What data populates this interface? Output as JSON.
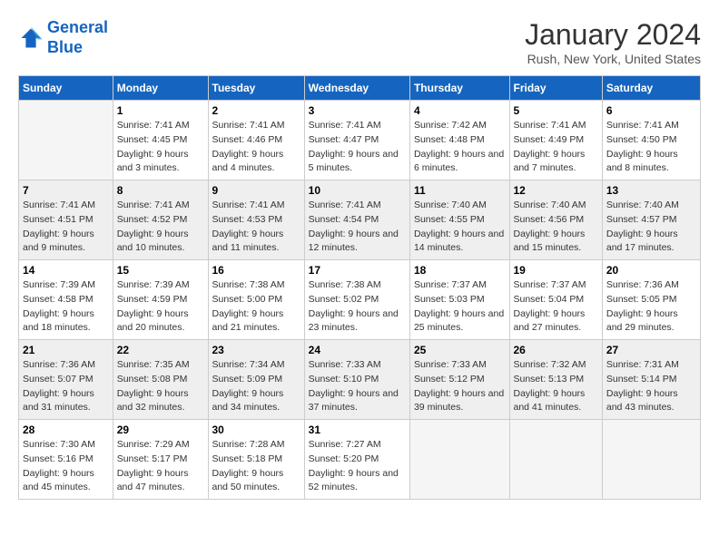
{
  "header": {
    "logo_line1": "General",
    "logo_line2": "Blue",
    "title": "January 2024",
    "subtitle": "Rush, New York, United States"
  },
  "days_of_week": [
    "Sunday",
    "Monday",
    "Tuesday",
    "Wednesday",
    "Thursday",
    "Friday",
    "Saturday"
  ],
  "weeks": [
    [
      {
        "num": "",
        "sunrise": "",
        "sunset": "",
        "daylight": "",
        "empty": true
      },
      {
        "num": "1",
        "sunrise": "Sunrise: 7:41 AM",
        "sunset": "Sunset: 4:45 PM",
        "daylight": "Daylight: 9 hours and 3 minutes."
      },
      {
        "num": "2",
        "sunrise": "Sunrise: 7:41 AM",
        "sunset": "Sunset: 4:46 PM",
        "daylight": "Daylight: 9 hours and 4 minutes."
      },
      {
        "num": "3",
        "sunrise": "Sunrise: 7:41 AM",
        "sunset": "Sunset: 4:47 PM",
        "daylight": "Daylight: 9 hours and 5 minutes."
      },
      {
        "num": "4",
        "sunrise": "Sunrise: 7:42 AM",
        "sunset": "Sunset: 4:48 PM",
        "daylight": "Daylight: 9 hours and 6 minutes."
      },
      {
        "num": "5",
        "sunrise": "Sunrise: 7:41 AM",
        "sunset": "Sunset: 4:49 PM",
        "daylight": "Daylight: 9 hours and 7 minutes."
      },
      {
        "num": "6",
        "sunrise": "Sunrise: 7:41 AM",
        "sunset": "Sunset: 4:50 PM",
        "daylight": "Daylight: 9 hours and 8 minutes."
      }
    ],
    [
      {
        "num": "7",
        "sunrise": "Sunrise: 7:41 AM",
        "sunset": "Sunset: 4:51 PM",
        "daylight": "Daylight: 9 hours and 9 minutes."
      },
      {
        "num": "8",
        "sunrise": "Sunrise: 7:41 AM",
        "sunset": "Sunset: 4:52 PM",
        "daylight": "Daylight: 9 hours and 10 minutes."
      },
      {
        "num": "9",
        "sunrise": "Sunrise: 7:41 AM",
        "sunset": "Sunset: 4:53 PM",
        "daylight": "Daylight: 9 hours and 11 minutes."
      },
      {
        "num": "10",
        "sunrise": "Sunrise: 7:41 AM",
        "sunset": "Sunset: 4:54 PM",
        "daylight": "Daylight: 9 hours and 12 minutes."
      },
      {
        "num": "11",
        "sunrise": "Sunrise: 7:40 AM",
        "sunset": "Sunset: 4:55 PM",
        "daylight": "Daylight: 9 hours and 14 minutes."
      },
      {
        "num": "12",
        "sunrise": "Sunrise: 7:40 AM",
        "sunset": "Sunset: 4:56 PM",
        "daylight": "Daylight: 9 hours and 15 minutes."
      },
      {
        "num": "13",
        "sunrise": "Sunrise: 7:40 AM",
        "sunset": "Sunset: 4:57 PM",
        "daylight": "Daylight: 9 hours and 17 minutes."
      }
    ],
    [
      {
        "num": "14",
        "sunrise": "Sunrise: 7:39 AM",
        "sunset": "Sunset: 4:58 PM",
        "daylight": "Daylight: 9 hours and 18 minutes."
      },
      {
        "num": "15",
        "sunrise": "Sunrise: 7:39 AM",
        "sunset": "Sunset: 4:59 PM",
        "daylight": "Daylight: 9 hours and 20 minutes."
      },
      {
        "num": "16",
        "sunrise": "Sunrise: 7:38 AM",
        "sunset": "Sunset: 5:00 PM",
        "daylight": "Daylight: 9 hours and 21 minutes."
      },
      {
        "num": "17",
        "sunrise": "Sunrise: 7:38 AM",
        "sunset": "Sunset: 5:02 PM",
        "daylight": "Daylight: 9 hours and 23 minutes."
      },
      {
        "num": "18",
        "sunrise": "Sunrise: 7:37 AM",
        "sunset": "Sunset: 5:03 PM",
        "daylight": "Daylight: 9 hours and 25 minutes."
      },
      {
        "num": "19",
        "sunrise": "Sunrise: 7:37 AM",
        "sunset": "Sunset: 5:04 PM",
        "daylight": "Daylight: 9 hours and 27 minutes."
      },
      {
        "num": "20",
        "sunrise": "Sunrise: 7:36 AM",
        "sunset": "Sunset: 5:05 PM",
        "daylight": "Daylight: 9 hours and 29 minutes."
      }
    ],
    [
      {
        "num": "21",
        "sunrise": "Sunrise: 7:36 AM",
        "sunset": "Sunset: 5:07 PM",
        "daylight": "Daylight: 9 hours and 31 minutes."
      },
      {
        "num": "22",
        "sunrise": "Sunrise: 7:35 AM",
        "sunset": "Sunset: 5:08 PM",
        "daylight": "Daylight: 9 hours and 32 minutes."
      },
      {
        "num": "23",
        "sunrise": "Sunrise: 7:34 AM",
        "sunset": "Sunset: 5:09 PM",
        "daylight": "Daylight: 9 hours and 34 minutes."
      },
      {
        "num": "24",
        "sunrise": "Sunrise: 7:33 AM",
        "sunset": "Sunset: 5:10 PM",
        "daylight": "Daylight: 9 hours and 37 minutes."
      },
      {
        "num": "25",
        "sunrise": "Sunrise: 7:33 AM",
        "sunset": "Sunset: 5:12 PM",
        "daylight": "Daylight: 9 hours and 39 minutes."
      },
      {
        "num": "26",
        "sunrise": "Sunrise: 7:32 AM",
        "sunset": "Sunset: 5:13 PM",
        "daylight": "Daylight: 9 hours and 41 minutes."
      },
      {
        "num": "27",
        "sunrise": "Sunrise: 7:31 AM",
        "sunset": "Sunset: 5:14 PM",
        "daylight": "Daylight: 9 hours and 43 minutes."
      }
    ],
    [
      {
        "num": "28",
        "sunrise": "Sunrise: 7:30 AM",
        "sunset": "Sunset: 5:16 PM",
        "daylight": "Daylight: 9 hours and 45 minutes."
      },
      {
        "num": "29",
        "sunrise": "Sunrise: 7:29 AM",
        "sunset": "Sunset: 5:17 PM",
        "daylight": "Daylight: 9 hours and 47 minutes."
      },
      {
        "num": "30",
        "sunrise": "Sunrise: 7:28 AM",
        "sunset": "Sunset: 5:18 PM",
        "daylight": "Daylight: 9 hours and 50 minutes."
      },
      {
        "num": "31",
        "sunrise": "Sunrise: 7:27 AM",
        "sunset": "Sunset: 5:20 PM",
        "daylight": "Daylight: 9 hours and 52 minutes."
      },
      {
        "num": "",
        "sunrise": "",
        "sunset": "",
        "daylight": "",
        "empty": true
      },
      {
        "num": "",
        "sunrise": "",
        "sunset": "",
        "daylight": "",
        "empty": true
      },
      {
        "num": "",
        "sunrise": "",
        "sunset": "",
        "daylight": "",
        "empty": true
      }
    ]
  ]
}
